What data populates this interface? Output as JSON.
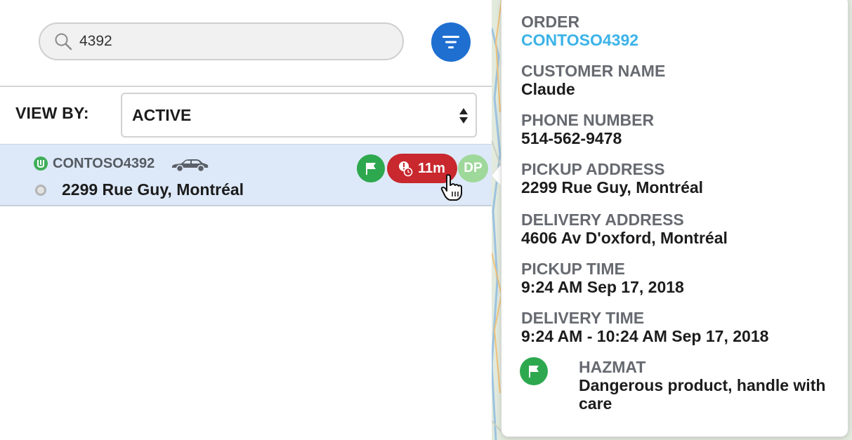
{
  "search": {
    "value": "4392"
  },
  "view_by": {
    "label": "VIEW BY:",
    "selected": "ACTIVE"
  },
  "order_row": {
    "order_id": "CONTOSO4392",
    "address": "2299 Rue Guy, Montréal",
    "timer": "11m",
    "driver_initials": "DP"
  },
  "tooltip": {
    "order_label": "ORDER",
    "order_value": "CONTOSO4392",
    "customer_label": "CUSTOMER NAME",
    "customer_value": "Claude",
    "phone_label": "PHONE NUMBER",
    "phone_value": "514-562-9478",
    "pickup_address_label": "PICKUP ADDRESS",
    "pickup_address_value": "2299 Rue Guy, Montréal",
    "delivery_address_label": "DELIVERY ADDRESS",
    "delivery_address_value": "4606 Av D'oxford, Montréal",
    "pickup_time_label": "PICKUP TIME",
    "pickup_time_value": "9:24 AM Sep 17, 2018",
    "delivery_time_label": "DELIVERY TIME",
    "delivery_time_value": "9:24 AM - 10:24 AM Sep 17, 2018",
    "hazmat_label": "HAZMAT",
    "hazmat_value": "Dangerous product, handle with care"
  },
  "colors": {
    "accent_blue": "#1f6fd1",
    "link_blue": "#3bb3e8",
    "flag_green": "#2ea84f",
    "alert_red": "#c8282e",
    "dp_green": "#9ed89a",
    "row_highlight": "#dde9f8"
  },
  "icons": {
    "search": "search-icon",
    "filter": "filter-icon",
    "select_arrows": "sort-arrows-icon",
    "status": "status-icon",
    "car": "car-icon",
    "flag": "flag-icon",
    "alert_timer": "alert-timer-icon",
    "cursor": "hand-cursor-icon"
  }
}
